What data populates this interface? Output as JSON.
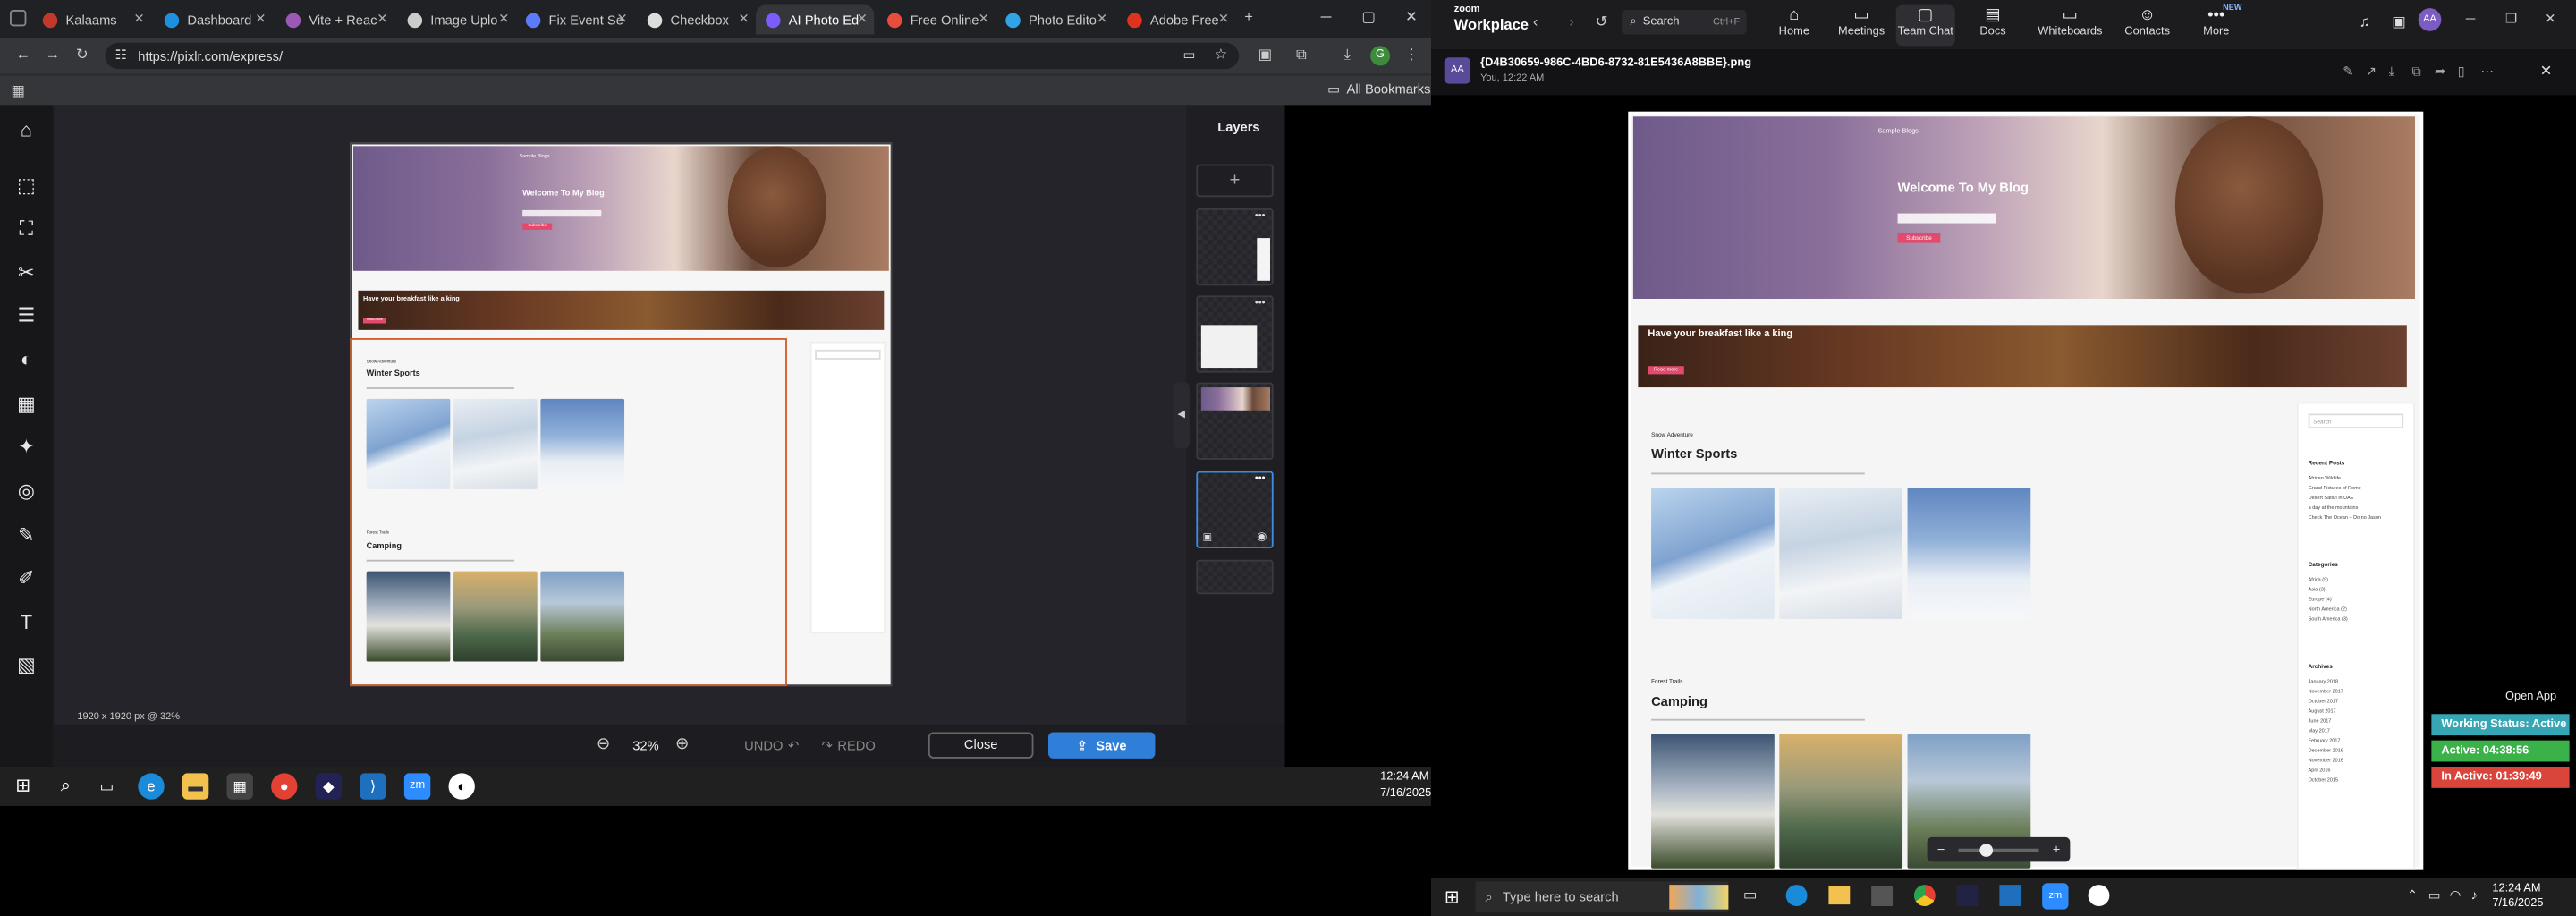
{
  "browser": {
    "tabs": [
      {
        "label": "Kalaams",
        "color": "#c0392b"
      },
      {
        "label": "Dashboard",
        "color": "#1f8fe0"
      },
      {
        "label": "Vite + Reac",
        "color": "#9b59b6"
      },
      {
        "label": "Image Uplo",
        "color": "#cccccc"
      },
      {
        "label": "Fix Event Se",
        "color": "#5b7cfa"
      },
      {
        "label": "Checkbox",
        "color": "#dddddd"
      },
      {
        "label": "AI Photo Ed",
        "color": "#7a5cff"
      },
      {
        "label": "Free Online",
        "color": "#e74c3c"
      },
      {
        "label": "Photo Edito",
        "color": "#2fa4e7"
      },
      {
        "label": "Adobe Free",
        "color": "#e0331d"
      }
    ],
    "active_tab_index": 6,
    "url": "https://pixlr.com/express/",
    "bookmarks_label": "All Bookmarks",
    "profile_initial": "G"
  },
  "pixlr": {
    "layers_title": "Layers",
    "add_layer_symbol": "+",
    "layer_menu_symbol": "•••",
    "canvas_info": "1920 x 1920 px @ 32%",
    "zoom_level": "32%",
    "undo_label": "UNDO",
    "redo_label": "REDO",
    "close_label": "Close",
    "save_label": "Save",
    "accent": "#2f7fd8"
  },
  "blog": {
    "logo": "Sample Blogs",
    "hero_title": "Welcome To My Blog",
    "hero_button": "Subscribe",
    "band_title": "Have your breakfast like a king",
    "band_button": "Read more",
    "section1_kicker": "Snow Adventure",
    "section1_title": "Winter Sports",
    "section2_kicker": "Forest Trails",
    "section2_title": "Camping",
    "search_placeholder": "Search",
    "recent_posts_title": "Recent Posts",
    "categories_title": "Categories",
    "archives_title": "Archives",
    "recent_posts": [
      "African Wildlife",
      "Grand Pictures of Rome",
      "Desert Safari in UAE",
      "a day at the mountains",
      "Check The Ocean – Do no Jason"
    ],
    "categories": [
      "Africa (9)",
      "Asia (3)",
      "Europe (4)",
      "North America (2)",
      "South America (3)"
    ],
    "archives": [
      "January 2018",
      "November 2017",
      "October 2017",
      "August 2017",
      "June 2017",
      "May 2017",
      "February 2017",
      "December 2016",
      "November 2016",
      "April 2016",
      "October 2015"
    ]
  },
  "taskbar_left": {
    "time": "12:24 AM",
    "date": "7/16/2025"
  },
  "zoom": {
    "brand_top": "zoom",
    "brand_bottom": "Workplace",
    "search_label": "Search",
    "search_shortcut": "Ctrl+F",
    "nav": [
      {
        "label": "Home",
        "icon": "home-icon"
      },
      {
        "label": "Meetings",
        "icon": "video-icon"
      },
      {
        "label": "Team Chat",
        "icon": "chat-icon"
      },
      {
        "label": "Docs",
        "icon": "docs-icon"
      },
      {
        "label": "Whiteboards",
        "icon": "whiteboard-icon"
      },
      {
        "label": "Contacts",
        "icon": "contacts-icon"
      },
      {
        "label": "More",
        "icon": "more-icon"
      }
    ],
    "active_nav_index": 2,
    "more_badge": "NEW",
    "avatar_initials": "AA",
    "file_name": "{D4B30659-986C-4BD6-8732-81E5436A8BBE}.png",
    "file_sender": "You, 12:22 AM",
    "open_app": "Open App",
    "working_status": "Working Status: Active",
    "active_time": "Active: 04:38:56",
    "inactive_time": "In Active: 01:39:49"
  },
  "taskbar_right": {
    "search_placeholder": "Type here to search",
    "time": "12:24 AM",
    "date": "7/16/2025"
  }
}
